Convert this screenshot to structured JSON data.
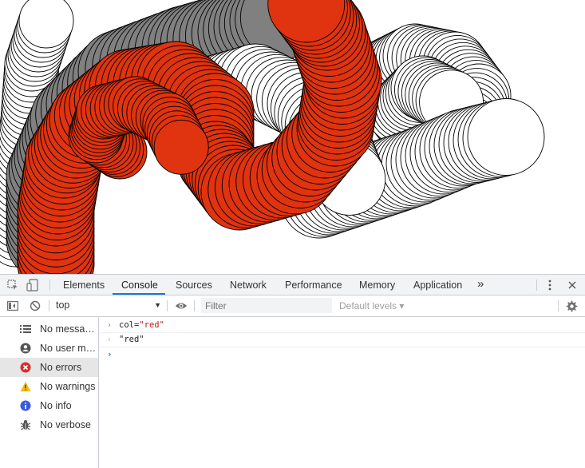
{
  "devtools": {
    "tabs": [
      {
        "label": "Elements",
        "active": false
      },
      {
        "label": "Console",
        "active": true
      },
      {
        "label": "Sources",
        "active": false
      },
      {
        "label": "Network",
        "active": false
      },
      {
        "label": "Performance",
        "active": false
      },
      {
        "label": "Memory",
        "active": false
      },
      {
        "label": "Application",
        "active": false
      }
    ],
    "more_tabs": "»",
    "toolbar": {
      "context": "top",
      "filter_placeholder": "Filter",
      "levels": "Default levels ▾"
    },
    "sidebar": [
      {
        "label": "No messages",
        "icon": "list-icon"
      },
      {
        "label": "No user me...",
        "icon": "user-icon"
      },
      {
        "label": "No errors",
        "icon": "error-icon",
        "selected": true
      },
      {
        "label": "No warnings",
        "icon": "warning-icon"
      },
      {
        "label": "No info",
        "icon": "info-icon"
      },
      {
        "label": "No verbose",
        "icon": "bug-icon"
      }
    ],
    "console": {
      "input_prefix": "col=",
      "input_value": "\"red\"",
      "result": "\"red\""
    }
  },
  "colors": {
    "accent": "#1a73e8",
    "art_red": "#e0330f",
    "art_gray": "#808080",
    "error": "#d93025",
    "warning": "#f4bb1b",
    "info": "#3b5bdb"
  }
}
